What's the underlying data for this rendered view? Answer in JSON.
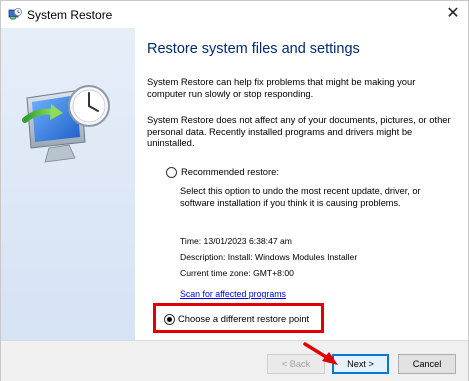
{
  "window": {
    "title": "System Restore",
    "close_glyph": "✕"
  },
  "content": {
    "heading": "Restore system files and settings",
    "paragraph1": "System Restore can help fix problems that might be making your computer run slowly or stop responding.",
    "paragraph2": "System Restore does not affect any of your documents, pictures, or other personal data. Recently installed programs and drivers might be uninstalled.",
    "recommended_label": "Recommended restore:",
    "recommended_description": "Select this option to undo the most recent update, driver, or software installation if you think it is causing problems.",
    "time": "Time: 13/01/2023 6:38:47 am",
    "description": "Description: Install: Windows Modules Installer",
    "time_zone": "Current time zone: GMT+8:00",
    "scan_link": "Scan for affected programs",
    "choose_label": "Choose a different restore point",
    "recommended_selected": false,
    "choose_selected": true
  },
  "footer": {
    "back_label": "< Back",
    "next_label": "Next >",
    "cancel_label": "Cancel"
  },
  "colors": {
    "highlight": "#e10000",
    "heading": "#002b6e",
    "link": "#0000ee",
    "default_button_border": "#0078d7"
  },
  "icons": {
    "title": "system-restore-icon",
    "hero": "computer-clock-restore-icon",
    "annotation": "red-arrow-icon"
  }
}
